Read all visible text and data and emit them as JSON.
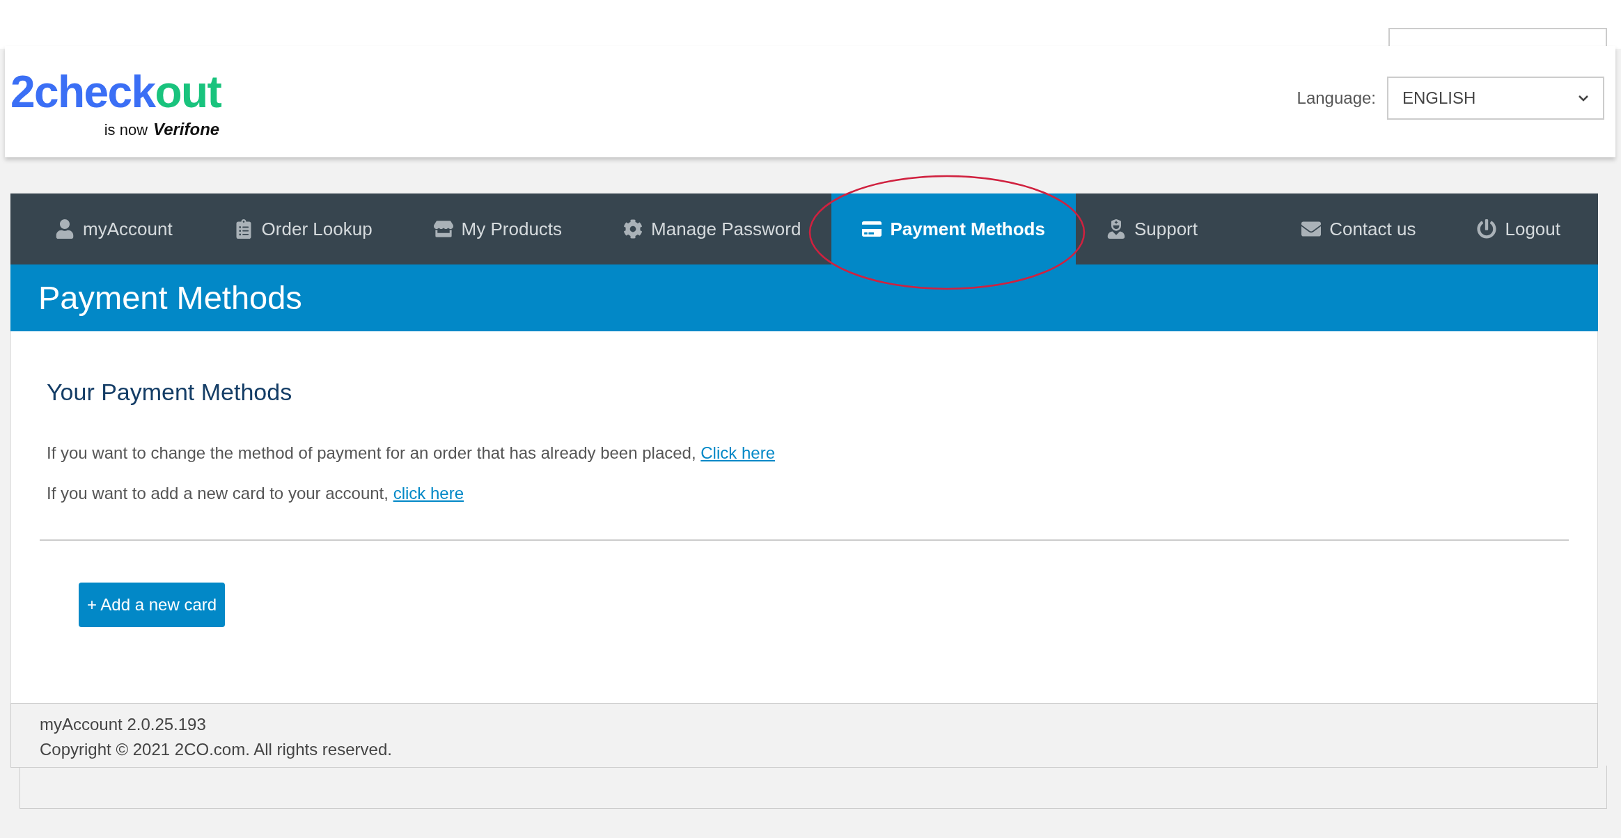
{
  "header": {
    "logo": {
      "primary": "2check",
      "accent": "out",
      "tagline": "is now",
      "brand": "Verifone"
    },
    "language_label": "Language:",
    "language_value": "ENGLISH"
  },
  "nav": {
    "left": [
      {
        "label": "myAccount",
        "selected": false
      },
      {
        "label": "Order Lookup",
        "selected": false
      },
      {
        "label": "My Products",
        "selected": false
      },
      {
        "label": "Manage Password",
        "selected": false
      },
      {
        "label": "Payment Methods",
        "selected": true
      },
      {
        "label": "Support",
        "selected": false
      }
    ],
    "right": [
      {
        "label": "Contact us",
        "selected": false
      },
      {
        "label": "Logout",
        "selected": false
      }
    ]
  },
  "page_title": "Payment Methods",
  "content": {
    "heading": "Your Payment Methods",
    "lines": [
      {
        "text": "If you want to change the method of payment for an order that has already been placed,",
        "link": "Click here"
      },
      {
        "text": "If you want to add a new card to your account,",
        "link": "click here"
      }
    ],
    "add_button": "+ Add a new card"
  },
  "footer": {
    "version": "myAccount 2.0.25.193",
    "copyright": "Copyright © 2021 2CO.com. All rights reserved."
  }
}
